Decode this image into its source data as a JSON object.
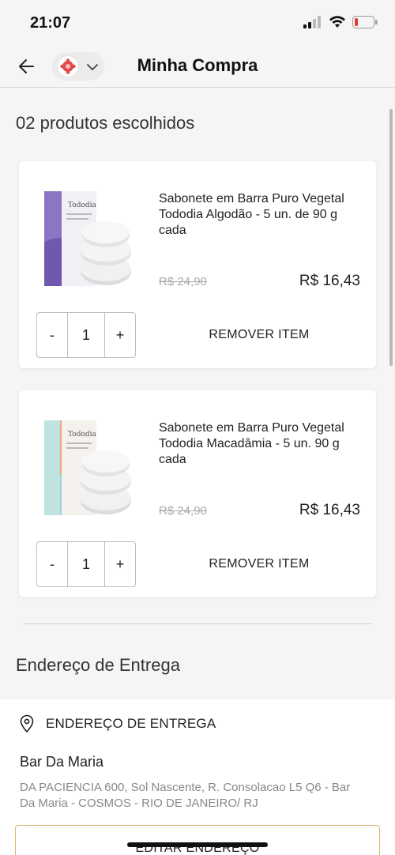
{
  "status_bar": {
    "time": "21:07"
  },
  "header": {
    "title": "Minha Compra"
  },
  "cart": {
    "count_title": "02 produtos escolhidos",
    "items": [
      {
        "name": "Sabonete em Barra Puro Vegetal Tododia Algodão - 5 un. de 90 g cada",
        "old_price": "R$ 24,90",
        "price": "R$ 16,43",
        "quantity": "1",
        "decrement_label": "-",
        "increment_label": "+",
        "remove_label": "REMOVER ITEM",
        "box_color": "#8c76c4",
        "box_label": "Tododia"
      },
      {
        "name": "Sabonete em Barra Puro Vegetal Tododia Macadâmia - 5 un. 90 g cada",
        "old_price": "R$ 24,90",
        "price": "R$ 16,43",
        "quantity": "1",
        "decrement_label": "-",
        "increment_label": "+",
        "remove_label": "REMOVER ITEM",
        "box_color": "#e8926a",
        "box_label": "Tododia"
      }
    ]
  },
  "delivery": {
    "section_title": "Endereço de Entrega",
    "heading": "ENDEREÇO DE ENTREGA",
    "name": "Bar Da Maria",
    "address": "DA PACIENCIA 600, Sol Nascente, R. Consolacao L5 Q6 - Bar Da Maria  - COSMOS - RIO DE JANEIRO/ RJ",
    "edit_label": "EDITAR ENDEREÇO"
  },
  "colors": {
    "accent_border": "#e0b66a",
    "battery_low": "#e03a3a"
  }
}
